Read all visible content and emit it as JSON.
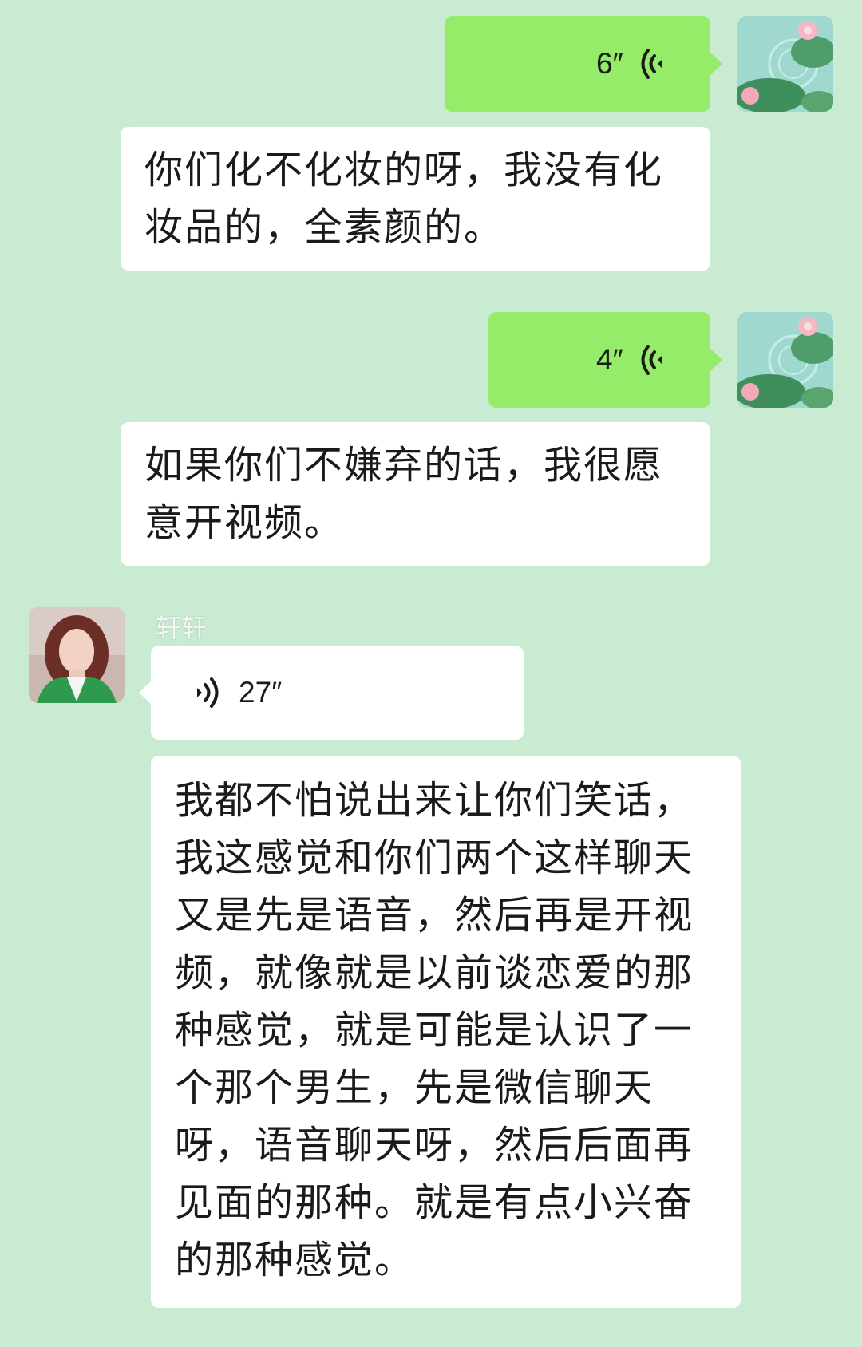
{
  "messages": [
    {
      "type": "voice",
      "direction": "out",
      "duration": "6″"
    },
    {
      "type": "text",
      "direction": "out",
      "text": "你们化不化妆的呀，我没有化妆品的，全素颜的。"
    },
    {
      "type": "voice",
      "direction": "out",
      "duration": "4″"
    },
    {
      "type": "text",
      "direction": "out",
      "text": "如果你们不嫌弃的话，我很愿意开视频。"
    },
    {
      "type": "voice",
      "direction": "in",
      "sender": "轩轩",
      "duration": "27″"
    },
    {
      "type": "text",
      "direction": "in",
      "text": "我都不怕说出来让你们笑话，我这感觉和你们两个这样聊天又是先是语音，然后再是开视频，就像就是以前谈恋爱的那种感觉，就是可能是认识了一个那个男生，先是微信聊天呀，语音聊天呀，然后后面再见面的那种。就是有点小兴奋的那种感觉。"
    }
  ],
  "colors": {
    "background": "#c8ebd2",
    "sent_bubble": "#95ec69",
    "received_bubble": "#ffffff"
  },
  "icons": {
    "voice_out": "voice-wave-left-icon",
    "voice_in": "voice-wave-right-icon",
    "self_avatar": "lotus-pond-avatar",
    "contact_avatar": "woman-portrait-avatar"
  }
}
